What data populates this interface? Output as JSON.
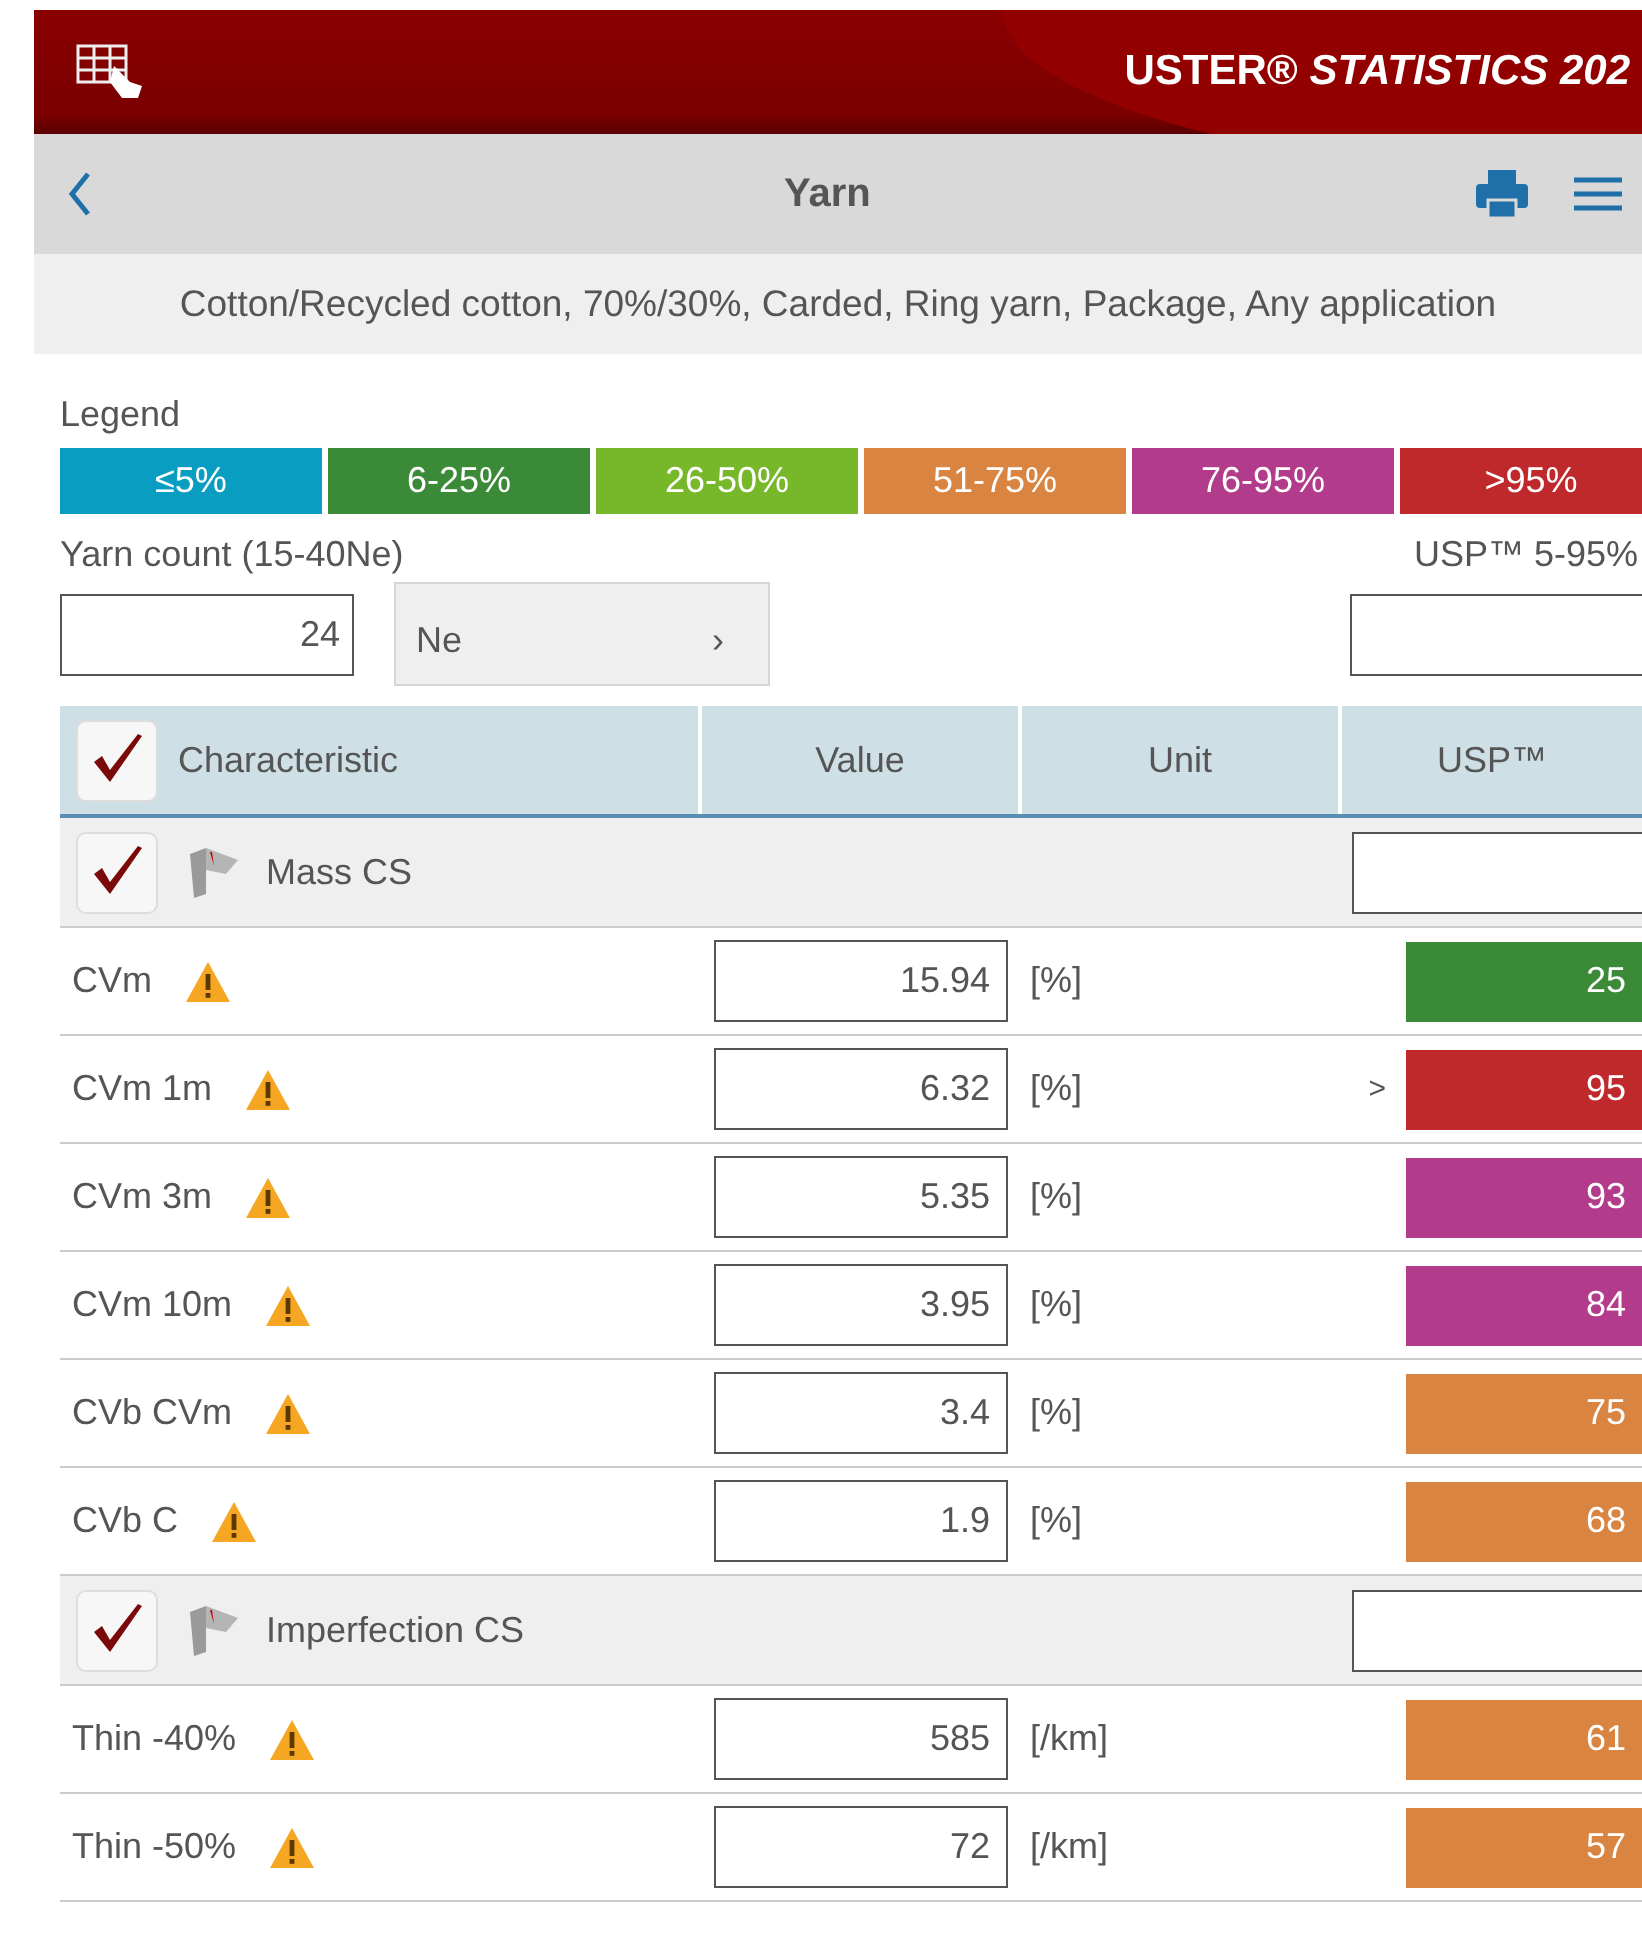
{
  "header": {
    "brand": "USTER® *STATISTICS 202*"
  },
  "nav": {
    "title": "Yarn"
  },
  "subtitle": "Cotton/Recycled cotton, 70%/30%, Carded, Ring yarn, Package, Any application",
  "legend": {
    "label": "Legend",
    "items": [
      {
        "label": "≤5%",
        "color": "#0a9dc2"
      },
      {
        "label": "6-25%",
        "color": "#3b8a37"
      },
      {
        "label": "26-50%",
        "color": "#77b72a"
      },
      {
        "label": "51-75%",
        "color": "#d98440"
      },
      {
        "label": "76-95%",
        "color": "#b23b8b"
      },
      {
        "label": ">95%",
        "color": "#c0292c"
      }
    ]
  },
  "yarn_count": {
    "label": "Yarn count (15-40Ne)",
    "value": "24",
    "unit": "Ne",
    "chevron": "›"
  },
  "usp_range": {
    "label": "USP™ 5-95%"
  },
  "table": {
    "checked": true,
    "columns": [
      "Characteristic",
      "Value",
      "Unit",
      "USP™"
    ],
    "groups": [
      {
        "name": "Mass CS",
        "checked": true,
        "rows": [
          {
            "name": "CVm",
            "value": "15.94",
            "unit": "[%]",
            "usp": "25",
            "color": "#3b8a37"
          },
          {
            "name": "CVm 1m",
            "value": "6.32",
            "unit": "[%]",
            "qualifier": ">",
            "usp": "95",
            "color": "#c0292c"
          },
          {
            "name": "CVm 3m",
            "value": "5.35",
            "unit": "[%]",
            "usp": "93",
            "color": "#b23b8b"
          },
          {
            "name": "CVm 10m",
            "value": "3.95",
            "unit": "[%]",
            "usp": "84",
            "color": "#b23b8b"
          },
          {
            "name": "CVb CVm",
            "value": "3.4",
            "unit": "[%]",
            "usp": "75",
            "color": "#d98440"
          },
          {
            "name": "CVb C",
            "value": "1.9",
            "unit": "[%]",
            "usp": "68",
            "color": "#d98440"
          }
        ]
      },
      {
        "name": "Imperfection CS",
        "checked": true,
        "rows": [
          {
            "name": "Thin -40%",
            "value": "585",
            "unit": "[/km]",
            "usp": "61",
            "color": "#d98440"
          },
          {
            "name": "Thin -50%",
            "value": "72",
            "unit": "[/km]",
            "usp": "57",
            "color": "#d98440"
          }
        ]
      }
    ]
  }
}
